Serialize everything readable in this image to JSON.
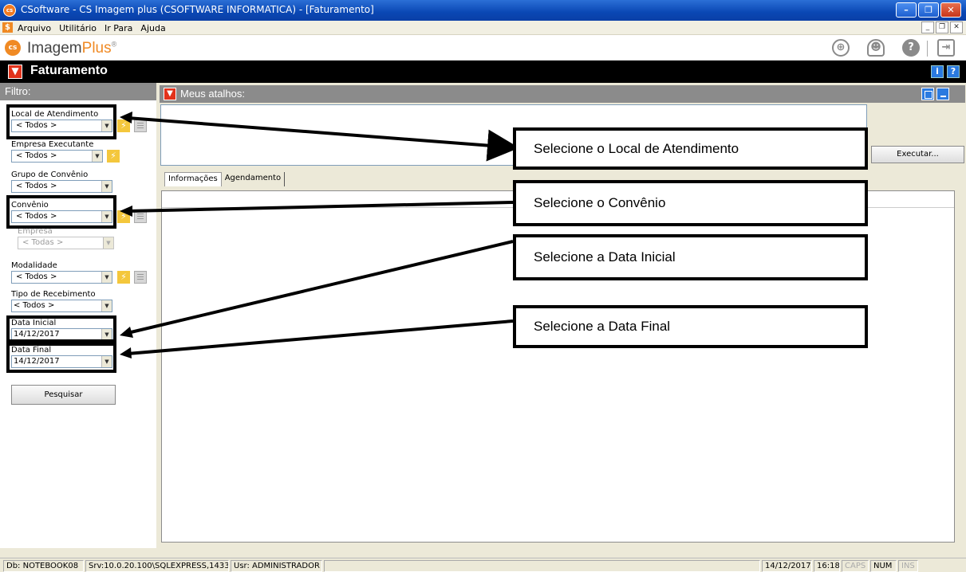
{
  "window": {
    "title": "CSoftware - CS Imagem plus (CSOFTWARE INFORMATICA) - [Faturamento]",
    "icon": "cs-app-icon",
    "buttons": [
      "minimize",
      "restore",
      "close"
    ]
  },
  "menu": {
    "items": [
      {
        "label": "Arquivo"
      },
      {
        "label": "Utilitário"
      },
      {
        "label": "Ir Para"
      },
      {
        "label": "Ajuda"
      }
    ]
  },
  "brand": {
    "logo_text": "cs",
    "name": "Imagem",
    "suffix": "Plus",
    "reg": "®",
    "accent": "#f08a24"
  },
  "module": {
    "title": "Faturamento"
  },
  "filter": {
    "header": "Filtro:",
    "fields": {
      "local": {
        "label": "Local de Atendimento",
        "value": "< Todos >"
      },
      "empresa_exec": {
        "label": "Empresa Executante",
        "value": "< Todos >"
      },
      "grupo_convenio": {
        "label": "Grupo de Convênio",
        "value": "< Todos >"
      },
      "convenio": {
        "label": "Convênio",
        "value": "< Todos >"
      },
      "empresa": {
        "label": "Empresa",
        "value": "< Todas >"
      },
      "modalidade": {
        "label": "Modalidade",
        "value": "< Todos >"
      },
      "tipo_recebimento": {
        "label": "Tipo de Recebimento",
        "value": "< Todos >"
      },
      "data_inicial": {
        "label": "Data Inicial",
        "value": "14/12/2017"
      },
      "data_final": {
        "label": "Data Final",
        "value": "14/12/2017"
      }
    },
    "search_button": "Pesquisar"
  },
  "shortcuts": {
    "header": "Meus atalhos:",
    "execute_button": "Executar..."
  },
  "tabs": [
    {
      "label": "Informações",
      "active": true
    },
    {
      "label": "Agendamento",
      "active": false
    }
  ],
  "callouts": {
    "local": "Selecione o Local de Atendimento",
    "convenio": "Selecione o Convênio",
    "data_inicial": "Selecione a Data Inicial",
    "data_final": "Selecione a Data Final"
  },
  "status": {
    "db": "Db: NOTEBOOK08",
    "srv": "Srv:10.0.20.100\\SQLEXPRESS,1433",
    "usr": "Usr: ADMINISTRADOR",
    "date": "14/12/2017",
    "time": "16:18",
    "caps": "CAPS",
    "num": "NUM",
    "ins": "INS"
  }
}
